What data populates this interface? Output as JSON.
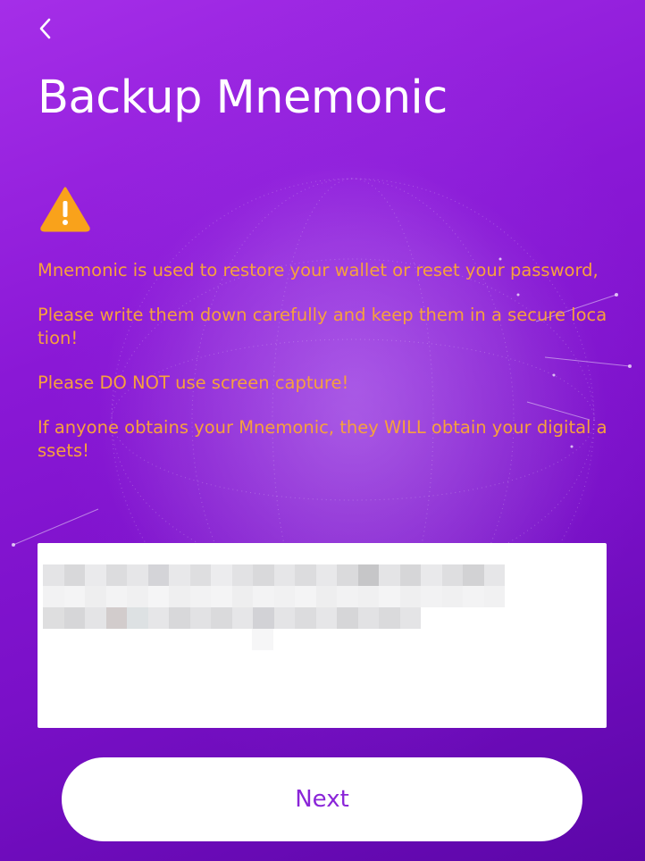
{
  "header": {
    "back_icon": "chevron-left-icon",
    "title": "Backup Mnemonic"
  },
  "warning": {
    "icon": "warning-triangle-icon",
    "icon_color": "#f9a21b",
    "text_color": "#f7a13c",
    "lines": [
      "Mnemonic is used to restore your wallet or reset your password,",
      "Please write them down carefully and keep them in a secure location!",
      "Please DO NOT use screen capture!",
      "If anyone obtains your Mnemonic, they WILL obtain your digital assets!"
    ]
  },
  "mnemonic": {
    "obscured": true
  },
  "footer": {
    "next_label": "Next",
    "next_text_color": "#8a25d8"
  }
}
